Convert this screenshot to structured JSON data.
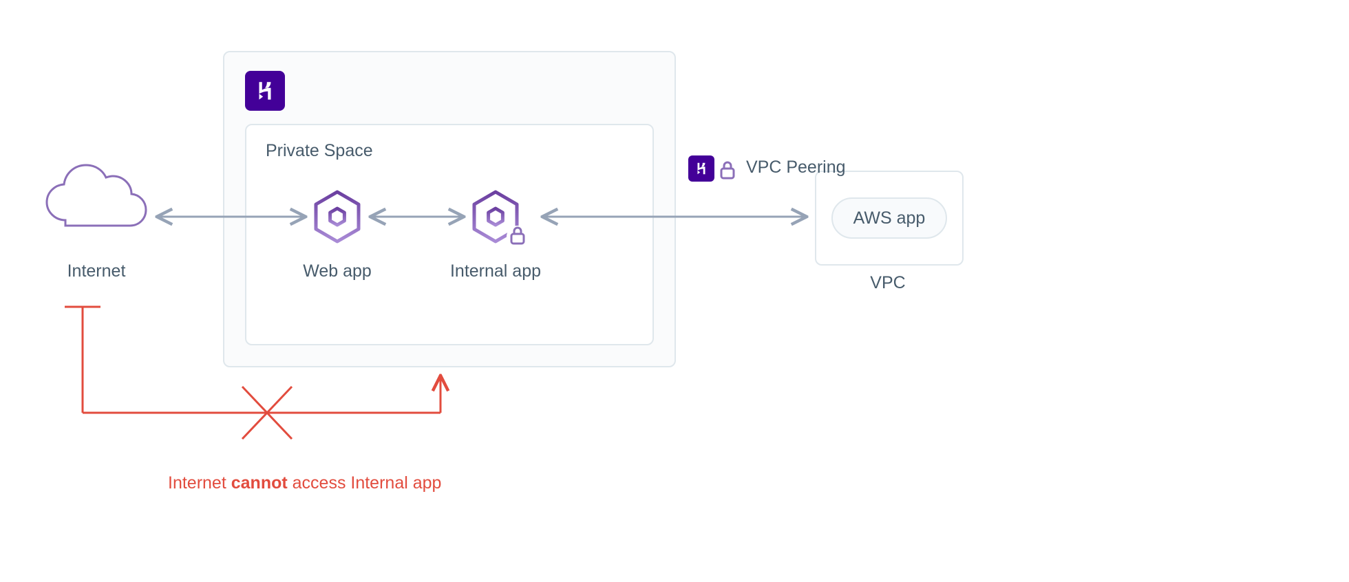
{
  "labels": {
    "internet": "Internet",
    "private_space": "Private Space",
    "web_app": "Web app",
    "internal_app": "Internal app",
    "vpc_peering": "VPC Peering",
    "aws_app": "AWS app",
    "vpc": "VPC"
  },
  "blocked": {
    "prefix": "Internet ",
    "emph": "cannot",
    "suffix": " access Internal app"
  },
  "colors": {
    "text": "#475B6B",
    "border": "#DFE7EC",
    "purple": "#6B3FA0",
    "heroku": "#430098",
    "arrow": "#96A3B6",
    "red": "#E24C3E"
  }
}
